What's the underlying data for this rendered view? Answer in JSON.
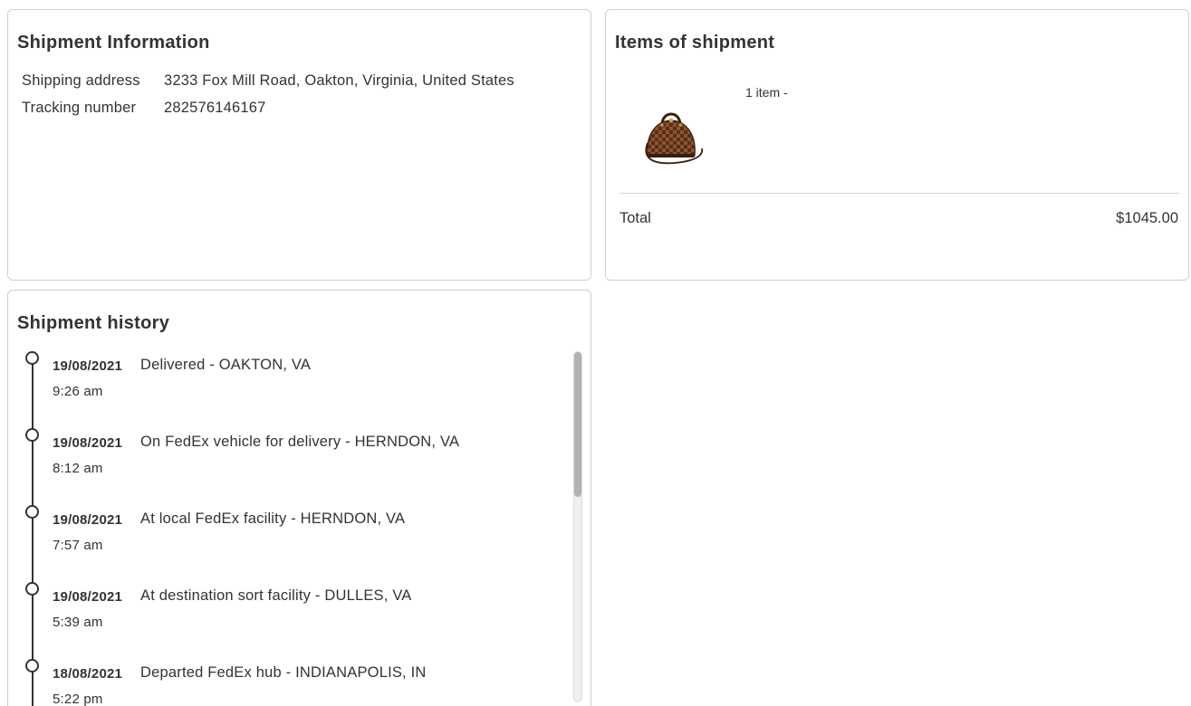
{
  "shipment_info": {
    "title": "Shipment Information",
    "rows": [
      {
        "label": "Shipping address",
        "value": "3233 Fox Mill Road, Oakton, Virginia, United States"
      },
      {
        "label": "Tracking number",
        "value": "282576146167"
      }
    ]
  },
  "items": {
    "title": "Items of shipment",
    "item_count": "1 item -",
    "total_label": "Total",
    "total_value": "$1045.00"
  },
  "history": {
    "title": "Shipment history",
    "events": [
      {
        "date": "19/08/2021",
        "description": "Delivered - OAKTON, VA",
        "time": "9:26 am"
      },
      {
        "date": "19/08/2021",
        "description": "On FedEx vehicle for delivery - HERNDON, VA",
        "time": "8:12 am"
      },
      {
        "date": "19/08/2021",
        "description": "At local FedEx facility - HERNDON, VA",
        "time": "7:57 am"
      },
      {
        "date": "19/08/2021",
        "description": "At destination sort facility - DULLES, VA",
        "time": "5:39 am"
      },
      {
        "date": "18/08/2021",
        "description": "Departed FedEx hub - INDIANAPOLIS, IN",
        "time": "5:22 pm"
      }
    ]
  }
}
